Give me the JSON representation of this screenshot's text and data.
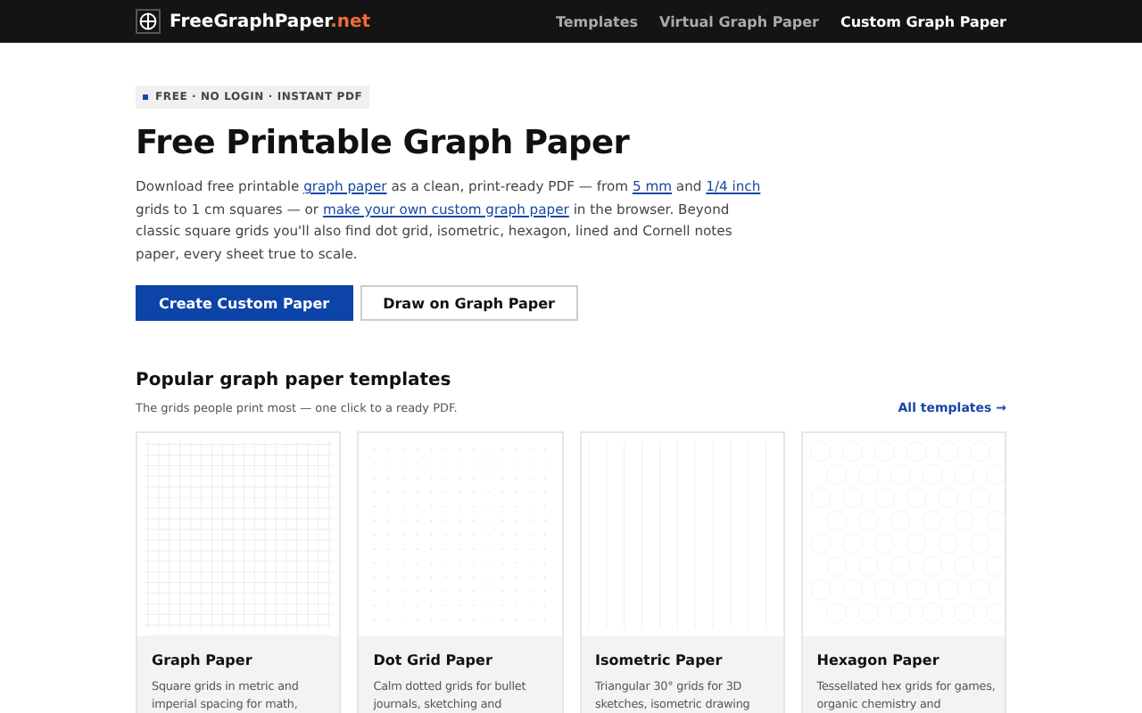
{
  "header": {
    "logo_name": "FreeGraphPaper",
    "logo_tld": ".net",
    "nav": [
      {
        "label": "Templates",
        "selected": false
      },
      {
        "label": "Virtual Graph Paper",
        "selected": false
      },
      {
        "label": "Custom Graph Paper",
        "selected": true
      }
    ]
  },
  "hero": {
    "badge": "FREE · NO LOGIN · INSTANT PDF",
    "title": "Free Printable Graph Paper",
    "intro": [
      {
        "text": "Download free printable ",
        "kind": "text"
      },
      {
        "text": "graph paper",
        "kind": "link"
      },
      {
        "text": " as a clean, print-ready PDF — from ",
        "kind": "text"
      },
      {
        "text": "5 mm",
        "kind": "link"
      },
      {
        "text": " and ",
        "kind": "text"
      },
      {
        "text": "1/4 inch",
        "kind": "link"
      },
      {
        "text": " grids to 1 cm squares — or ",
        "kind": "text"
      },
      {
        "text": "make your own custom graph paper",
        "kind": "link"
      },
      {
        "text": " in the browser. Beyond classic square grids you'll also find dot grid, isometric, hexagon, lined and Cornell notes paper, every sheet true to scale.",
        "kind": "text"
      }
    ],
    "buttons": [
      {
        "label": "Create Custom Paper",
        "kind": "primary"
      },
      {
        "label": "Draw on Graph Paper",
        "kind": "secondary"
      }
    ]
  },
  "templates": {
    "title": "Popular graph paper templates",
    "subtitle": "The grids people print most — one click to a ready PDF.",
    "all_link": "All templates →",
    "cards": [
      {
        "kind": "square",
        "title": "Graph Paper",
        "text": "Square grids in metric and imperial spacing for math,"
      },
      {
        "kind": "dot",
        "title": "Dot Grid Paper",
        "text": "Calm dotted grids for bullet journals, sketching and"
      },
      {
        "kind": "isometric",
        "title": "Isometric Paper",
        "text": "Triangular 30° grids for 3D sketches, isometric drawing"
      },
      {
        "kind": "hex",
        "title": "Hexagon Paper",
        "text": "Tessellated hex grids for games, organic chemistry and"
      }
    ]
  }
}
